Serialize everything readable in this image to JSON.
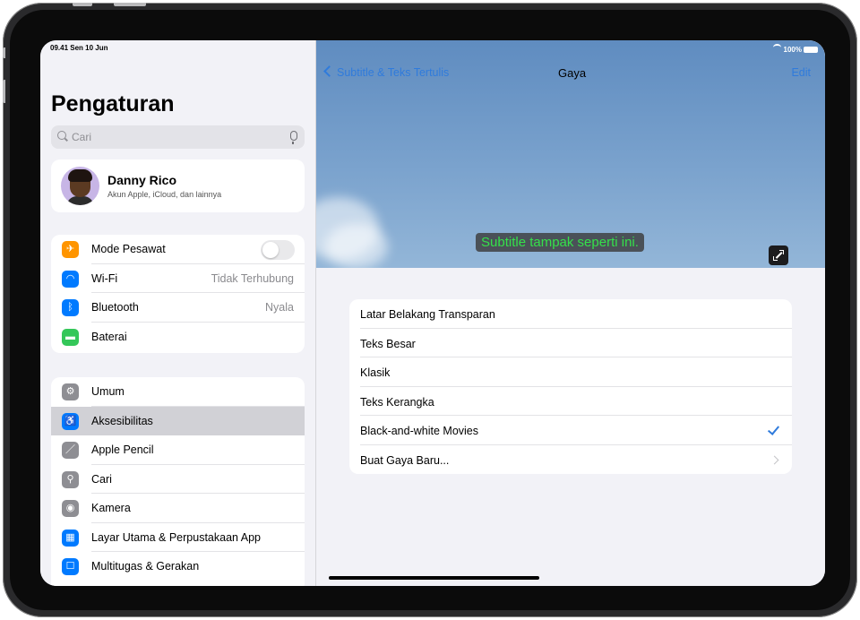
{
  "status": {
    "time": "09.41",
    "date": "Sen 10 Jun",
    "battery": "100%"
  },
  "sidebar": {
    "title": "Pengaturan",
    "search_placeholder": "Cari",
    "profile": {
      "name": "Danny Rico",
      "subtitle": "Akun Apple, iCloud, dan lainnya"
    },
    "group1": [
      {
        "label": "Mode Pesawat",
        "icon": "airplane-icon",
        "color": "#ff9500",
        "control": "toggle-off"
      },
      {
        "label": "Wi-Fi",
        "value": "Tidak Terhubung",
        "icon": "wifi-icon",
        "color": "#007aff"
      },
      {
        "label": "Bluetooth",
        "value": "Nyala",
        "icon": "bluetooth-icon",
        "color": "#007aff"
      },
      {
        "label": "Baterai",
        "icon": "battery-icon",
        "color": "#34c759"
      }
    ],
    "group2": [
      {
        "label": "Umum",
        "icon": "gear-icon",
        "color": "#8e8e93"
      },
      {
        "label": "Aksesibilitas",
        "icon": "accessibility-icon",
        "color": "#007aff",
        "selected": true
      },
      {
        "label": "Apple Pencil",
        "icon": "pencil-icon",
        "color": "#8e8e93"
      },
      {
        "label": "Cari",
        "icon": "search-icon",
        "color": "#8e8e93"
      },
      {
        "label": "Kamera",
        "icon": "camera-icon",
        "color": "#8e8e93"
      },
      {
        "label": "Layar Utama & Perpustakaan App",
        "icon": "home-screen-icon",
        "color": "#007aff"
      },
      {
        "label": "Multitugas & Gerakan",
        "icon": "multitasking-icon",
        "color": "#007aff"
      }
    ]
  },
  "detail": {
    "back_label": "Subtitle & Teks Tertulis",
    "title": "Gaya",
    "edit_label": "Edit",
    "preview_text": "Subtitle tampak seperti ini.",
    "styles": [
      {
        "label": "Latar Belakang Transparan"
      },
      {
        "label": "Teks Besar"
      },
      {
        "label": "Klasik"
      },
      {
        "label": "Teks Kerangka"
      },
      {
        "label": "Black-and-white Movies",
        "checked": true
      },
      {
        "label": "Buat Gaya Baru...",
        "chevron": true
      }
    ]
  },
  "colors": {
    "accent": "#2f7bdc",
    "subtitle_text": "#35e04a"
  }
}
